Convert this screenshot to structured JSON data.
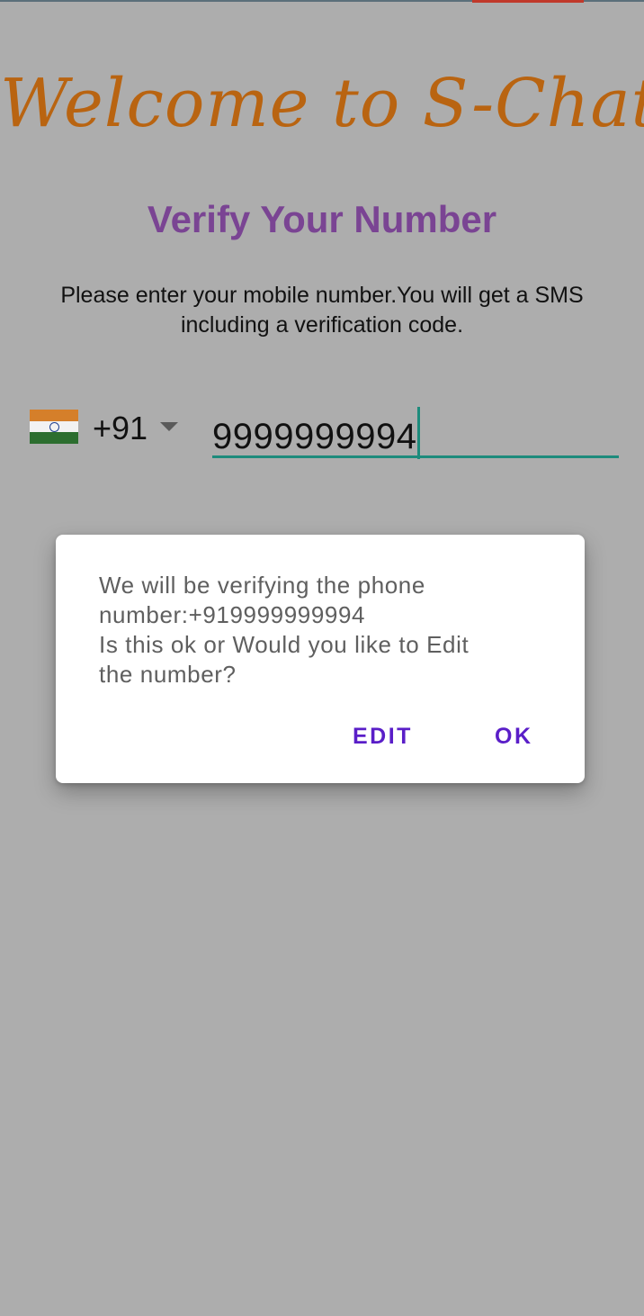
{
  "app": {
    "title": "Welcome to S-Chat",
    "heading": "Verify Your Number",
    "instructions": "Please enter your mobile number.You will get a SMS including a verification code."
  },
  "phone": {
    "country_flag": "india-flag-icon",
    "country_code": "+91",
    "number": "9999999994"
  },
  "dialog": {
    "message_lines": [
      "We will be verifying the phone",
      "number:+919999999994",
      "Is this ok or Would you like to Edit",
      "the number?"
    ],
    "edit_label": "EDIT",
    "ok_label": "OK"
  },
  "colors": {
    "title": "#b96411",
    "heading": "#7a4493",
    "accent": "#1d8b7c",
    "dialog_button": "#5a1ec8",
    "scrim": "#adadad"
  }
}
